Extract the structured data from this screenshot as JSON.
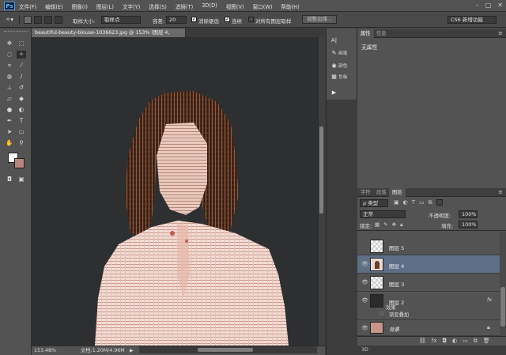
{
  "app": {
    "logo": "Ps"
  },
  "menu": [
    "文件(F)",
    "编辑(E)",
    "图像(I)",
    "图层(L)",
    "文字(Y)",
    "选择(S)",
    "滤镜(T)",
    "3D(D)",
    "视图(V)",
    "窗口(W)",
    "帮助(H)"
  ],
  "window_controls": [
    "–",
    "□",
    "✕"
  ],
  "options": {
    "sample_size_label": "取样大小:",
    "sample_size_value": "取样点",
    "tolerance_label": "容差:",
    "tolerance_value": "20",
    "antialias_label": "消除锯齿",
    "contiguous_label": "连续",
    "all_layers_label": "对所有图层取样",
    "refine_edge_button": "调整边缘...",
    "workspace": "CS6 新增功能"
  },
  "document": {
    "tab_title": "beautiful-beauty-blouse-1036623.jpg @ 153% (图层 4, RGB/8) *",
    "tab_close": "×",
    "zoom": "153.48%",
    "doc_info": "文档:1.20M/4.96M"
  },
  "mini_panel": [
    {
      "icon": "A|",
      "label": ""
    },
    {
      "icon": "✎",
      "label": "画笔"
    },
    {
      "icon": "◉",
      "label": "颜色"
    },
    {
      "icon": "▦",
      "label": "色板"
    },
    {
      "icon": "▶",
      "label": ""
    }
  ],
  "properties_panel": {
    "tabs": [
      "属性",
      "信息"
    ],
    "content": "无属性"
  },
  "layers_panel": {
    "tabs": [
      "字符",
      "段落",
      "图层"
    ],
    "filter_label": "ρ 类型",
    "blend_mode": "正常",
    "opacity_label": "不透明度:",
    "opacity_value": "100%",
    "lock_label": "锁定:",
    "fill_label": "填充:",
    "fill_value": "100%",
    "layers": [
      {
        "name": "图层 5",
        "visible": false,
        "selected": false
      },
      {
        "name": "图层 4",
        "visible": true,
        "selected": true
      },
      {
        "name": "图层 3",
        "visible": true,
        "selected": false
      },
      {
        "name": "图层 2",
        "visible": true,
        "selected": false,
        "fx": "fx",
        "effects_label": "效果",
        "effect_item": "渐变叠加"
      },
      {
        "name": "背景",
        "visible": true,
        "selected": false
      }
    ]
  },
  "bottom_bar": {
    "label": "3D"
  },
  "colors": {
    "accent_selected": "#5d6e87",
    "foreground": "#ffffff",
    "background": "#b8867c"
  }
}
